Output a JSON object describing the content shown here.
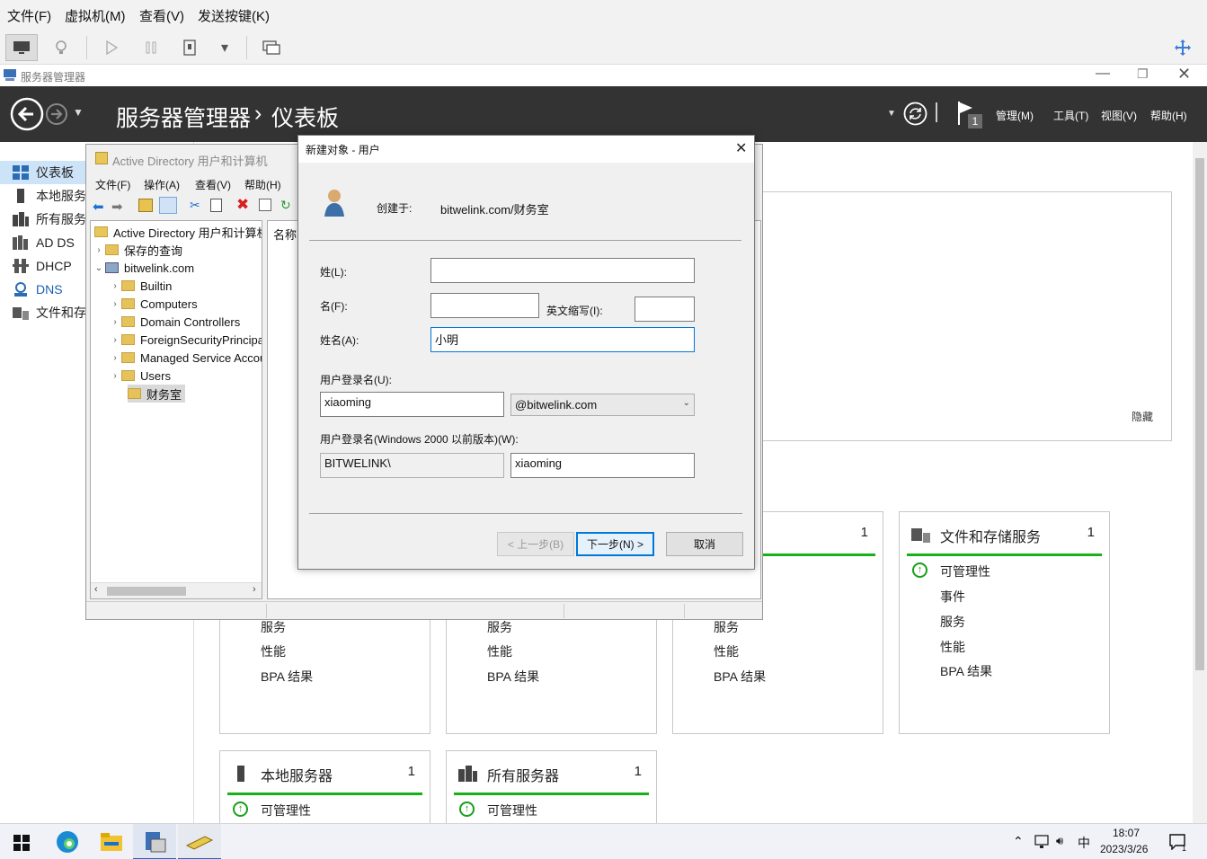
{
  "vm_menu": {
    "file": "文件(F)",
    "vm": "虚拟机(M)",
    "view": "查看(V)",
    "send_keys": "发送按键(K)"
  },
  "sm": {
    "window_title": "服务器管理器",
    "breadcrumb_root": "服务器管理器",
    "breadcrumb_sep": "›",
    "breadcrumb_page": "仪表板",
    "flag_count": "1",
    "menu_manage": "管理(M)",
    "menu_tools": "工具(T)",
    "menu_view": "视图(V)",
    "menu_help": "帮助(H)",
    "hide_link": "隐藏",
    "sidebar": [
      {
        "label": "仪表板",
        "icon": "dashboard-icon"
      },
      {
        "label": "本地服务",
        "icon": "server-icon"
      },
      {
        "label": "所有服务",
        "icon": "servers-icon"
      },
      {
        "label": "AD DS",
        "icon": "adds-icon"
      },
      {
        "label": "DHCP",
        "icon": "dhcp-icon"
      },
      {
        "label": "DNS",
        "icon": "dns-icon"
      },
      {
        "label": "文件和存",
        "icon": "file-storage-icon"
      }
    ],
    "tiles_top": [
      {
        "rows": [
          "服务",
          "性能",
          "BPA 结果"
        ]
      },
      {
        "rows": [
          "服务",
          "性能",
          "BPA 结果"
        ]
      },
      {
        "count": "1",
        "rows": [
          "服务",
          "性能",
          "BPA 结果"
        ]
      },
      {
        "title": "文件和存储服务",
        "count": "1",
        "rows": [
          "可管理性",
          "事件",
          "服务",
          "性能",
          "BPA 结果"
        ]
      }
    ],
    "tiles_bottom": [
      {
        "title": "本地服务器",
        "count": "1",
        "row1": "可管理性"
      },
      {
        "title": "所有服务器",
        "count": "1",
        "row1": "可管理性"
      }
    ]
  },
  "ad": {
    "title": "Active Directory 用户和计算机",
    "menu_file": "文件(F)",
    "menu_action": "操作(A)",
    "menu_view": "查看(V)",
    "menu_help": "帮助(H)",
    "col_name": "名称",
    "tree": {
      "root": "Active Directory 用户和计算机",
      "saved_queries": "保存的查询",
      "domain": "bitwelink.com",
      "children": [
        "Builtin",
        "Computers",
        "Domain Controllers",
        "ForeignSecurityPrincipals",
        "Managed Service Accounts",
        "Users"
      ],
      "selected": "财务室"
    }
  },
  "dialog": {
    "title": "新建对象 - 用户",
    "created_in_label": "创建于:",
    "created_in_value": "bitwelink.com/财务室",
    "last_name_label": "姓(L):",
    "last_name_value": "",
    "first_name_label": "名(F):",
    "first_name_value": "",
    "initials_label": "英文缩写(I):",
    "initials_value": "",
    "full_name_label": "姓名(A):",
    "full_name_value": "小明",
    "logon_label": "用户登录名(U):",
    "logon_value": "xiaoming",
    "logon_domain": "@bitwelink.com",
    "pre2000_label": "用户登录名(Windows 2000 以前版本)(W):",
    "pre2000_domain": "BITWELINK\\",
    "pre2000_value": "xiaoming",
    "btn_back": "< 上一步(B)",
    "btn_next": "下一步(N) >",
    "btn_cancel": "取消"
  },
  "taskbar": {
    "ime": "中",
    "time": "18:07",
    "date": "2023/3/26",
    "notif_count": "1"
  },
  "colors": {
    "header_bg": "#333333",
    "tile_green": "#18b218",
    "accent_blue": "#0078d7"
  }
}
